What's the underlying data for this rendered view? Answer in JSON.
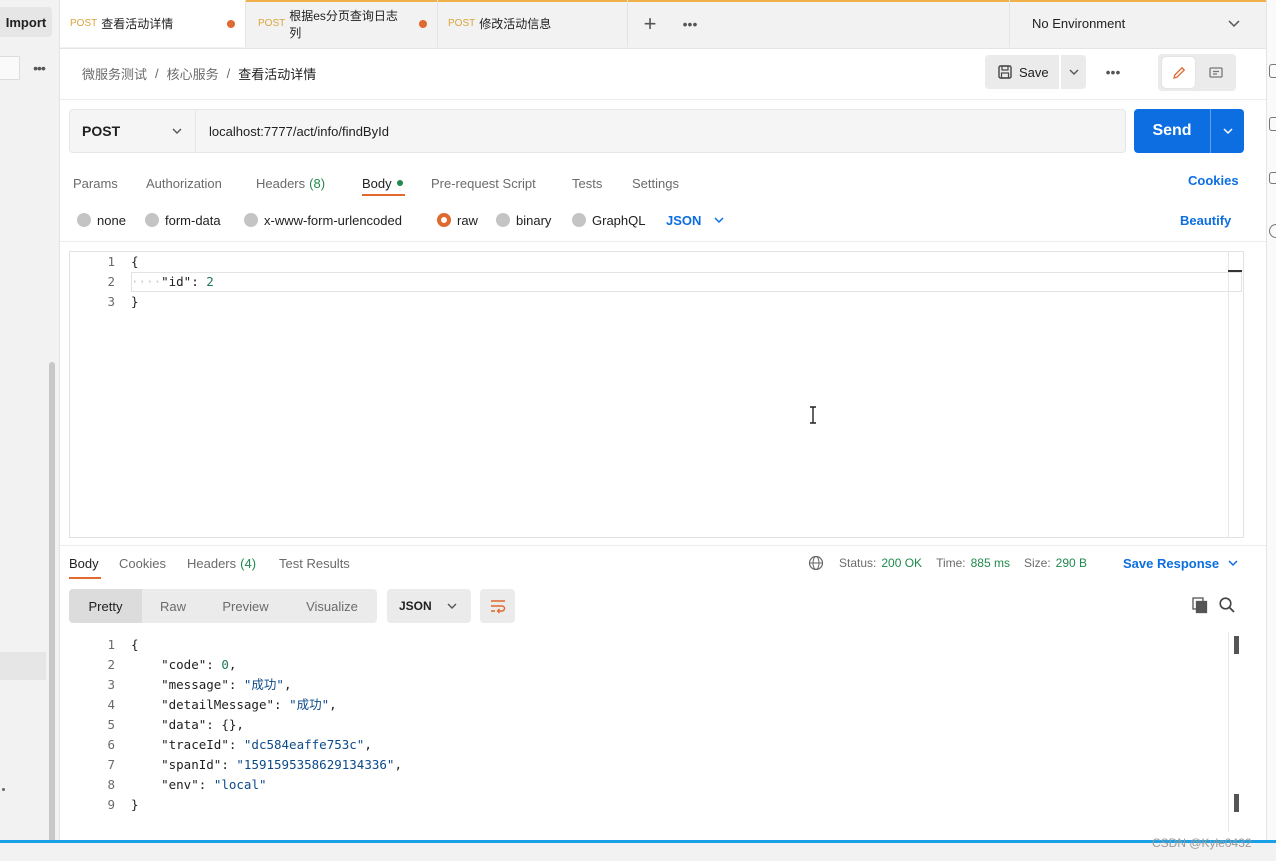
{
  "sidebar": {
    "import_label": "Import"
  },
  "tabs": [
    {
      "method": "POST",
      "title": "查看活动详情",
      "unsaved": true,
      "active": true
    },
    {
      "method": "POST",
      "title": "根据es分页查询日志列",
      "unsaved": true,
      "active": false
    },
    {
      "method": "POST",
      "title": "修改活动信息",
      "unsaved": false,
      "active": false
    }
  ],
  "environment": {
    "label": "No Environment"
  },
  "breadcrumb": {
    "root": "微服务测试",
    "folder": "核心服务",
    "current": "查看活动详情"
  },
  "toolbar": {
    "save_label": "Save"
  },
  "request": {
    "method": "POST",
    "url": "localhost:7777/act/info/findById",
    "send_label": "Send"
  },
  "request_tabs": {
    "params": "Params",
    "authorization": "Authorization",
    "headers": "Headers",
    "headers_count": "(8)",
    "body": "Body",
    "pre_request": "Pre-request Script",
    "tests": "Tests",
    "settings": "Settings",
    "cookies": "Cookies"
  },
  "body_modes": {
    "none": "none",
    "form_data": "form-data",
    "urlencoded": "x-www-form-urlencoded",
    "raw": "raw",
    "binary": "binary",
    "graphql": "GraphQL",
    "selected": "raw",
    "language": "JSON",
    "beautify": "Beautify"
  },
  "request_body_lines": [
    {
      "n": "1",
      "text": "{"
    },
    {
      "n": "2",
      "key": "\"id\"",
      "value": "2"
    },
    {
      "n": "3",
      "text": "}"
    }
  ],
  "response_tabs": {
    "body": "Body",
    "cookies": "Cookies",
    "headers": "Headers",
    "headers_count": "(4)",
    "test_results": "Test Results"
  },
  "response_meta": {
    "status_label": "Status:",
    "status": "200 OK",
    "time_label": "Time:",
    "time": "885 ms",
    "size_label": "Size:",
    "size": "290 B",
    "save_response": "Save Response"
  },
  "response_views": {
    "pretty": "Pretty",
    "raw": "Raw",
    "preview": "Preview",
    "visualize": "Visualize",
    "language": "JSON"
  },
  "response_body_lines": [
    {
      "n": "1",
      "text": "{"
    },
    {
      "n": "2",
      "key": "\"code\"",
      "value": "0",
      "type": "num",
      "comma": true
    },
    {
      "n": "3",
      "key": "\"message\"",
      "value": "\"成功\"",
      "type": "str",
      "comma": true
    },
    {
      "n": "4",
      "key": "\"detailMessage\"",
      "value": "\"成功\"",
      "type": "str",
      "comma": true
    },
    {
      "n": "5",
      "key": "\"data\"",
      "value": "{}",
      "type": "punc",
      "comma": true
    },
    {
      "n": "6",
      "key": "\"traceId\"",
      "value": "\"dc584eaffe753c\"",
      "type": "str",
      "comma": true
    },
    {
      "n": "7",
      "key": "\"spanId\"",
      "value": "\"1591595358629134336\"",
      "type": "str",
      "comma": true
    },
    {
      "n": "8",
      "key": "\"env\"",
      "value": "\"local\"",
      "type": "str",
      "comma": false
    },
    {
      "n": "9",
      "text": "}"
    }
  ],
  "watermark": "CSDN @Kyle0432",
  "colors": {
    "accent": "#e0692d",
    "primary": "#0c6ee0",
    "success": "#1f8a4c",
    "tab_stripe": "#f0b14a"
  }
}
